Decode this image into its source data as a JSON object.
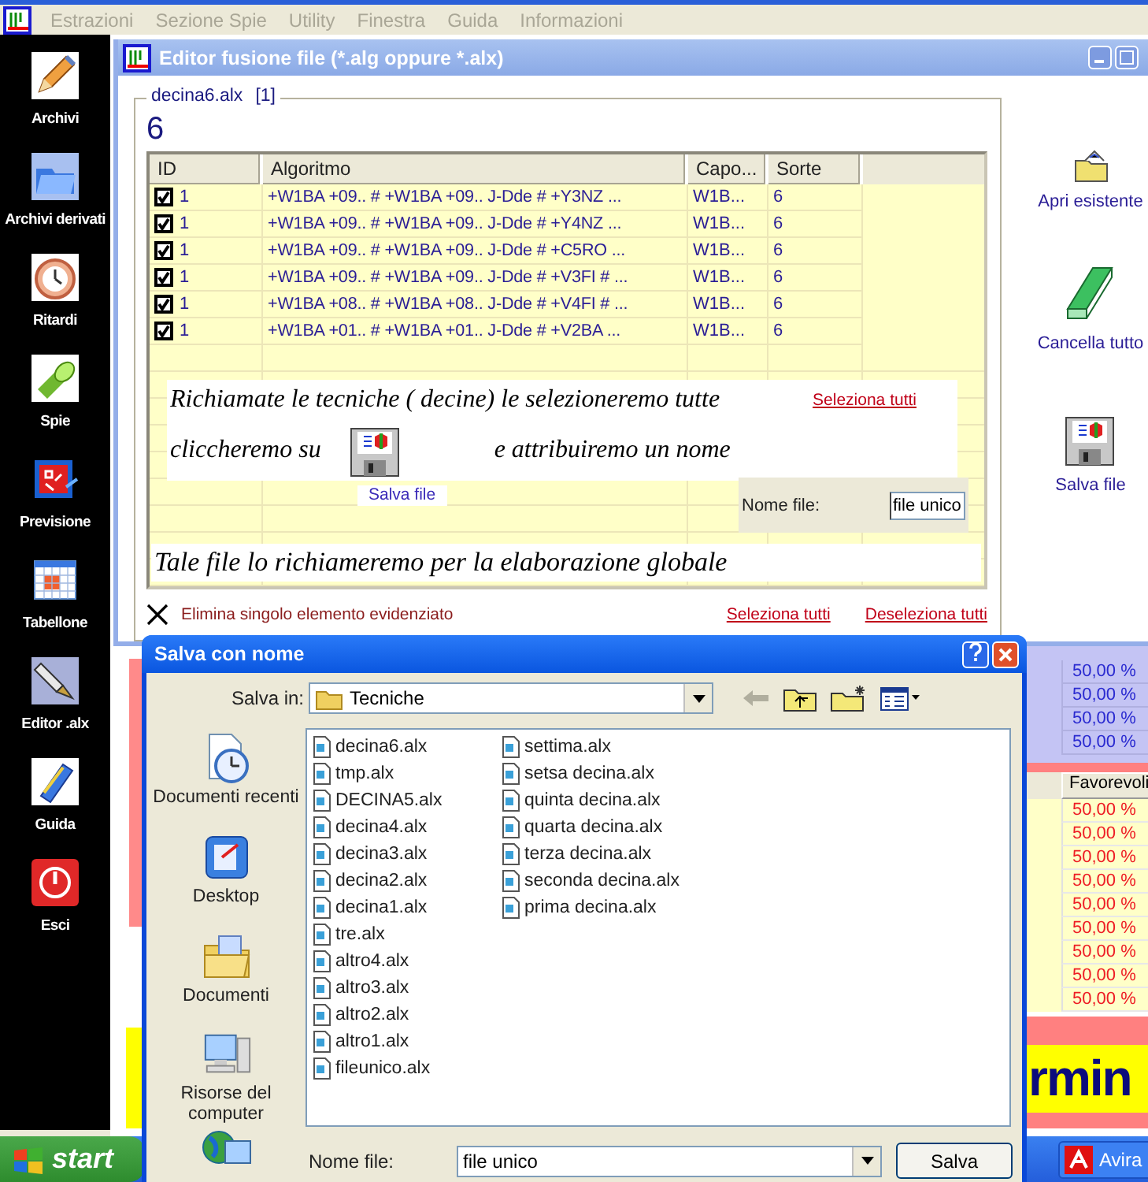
{
  "menu_bar": [
    "Estrazioni",
    "Sezione Spie",
    "Utility",
    "Finestra",
    "Guida",
    "Informazioni"
  ],
  "sidebar": [
    "Archivi",
    "Archivi derivati",
    "Ritardi",
    "Spie",
    "Previsione",
    "Tabellone",
    "Editor .alx",
    "Guida",
    "Esci"
  ],
  "editor": {
    "title": "Editor fusione file (*.alg oppure *.alx)",
    "file_name": "decina6.alx",
    "file_index": "[1]",
    "count": "6",
    "table": {
      "columns": [
        "ID",
        "Algoritmo",
        "Capo...",
        "Sorte"
      ],
      "rows": [
        {
          "checked": true,
          "id": "1",
          "algoritmo": "+W1BA +09.. # +W1BA +09.. J-Dde # +Y3NZ ...",
          "capo": "W1B...",
          "sorte": "6"
        },
        {
          "checked": true,
          "id": "1",
          "algoritmo": "+W1BA +09.. # +W1BA +09.. J-Dde # +Y4NZ ...",
          "capo": "W1B...",
          "sorte": "6"
        },
        {
          "checked": true,
          "id": "1",
          "algoritmo": "+W1BA +09.. # +W1BA +09.. J-Dde # +C5RO ...",
          "capo": "W1B...",
          "sorte": "6"
        },
        {
          "checked": true,
          "id": "1",
          "algoritmo": "+W1BA +09.. # +W1BA +09.. J-Dde # +V3FI # ...",
          "capo": "W1B...",
          "sorte": "6"
        },
        {
          "checked": true,
          "id": "1",
          "algoritmo": "+W1BA +08.. # +W1BA +08.. J-Dde # +V4FI # ...",
          "capo": "W1B...",
          "sorte": "6"
        },
        {
          "checked": true,
          "id": "1",
          "algoritmo": "+W1BA +01.. # +W1BA +01.. J-Dde # +V2BA ...",
          "capo": "W1B...",
          "sorte": "6"
        }
      ]
    },
    "instructions": {
      "line_1": "Richiamate le tecniche ( decine) le selezioneremo tutte",
      "select_all": "Seleziona tutti",
      "line_2a": "cliccheremo su",
      "save_label": "Salva file",
      "line_2b": "e attribuiremo un nome",
      "name_label": "Nome file:",
      "name_value": "file unico",
      "line_3": "Tale file lo richiameremo per la elaborazione globale"
    },
    "delete_label": "Elimina singolo elemento evidenziato",
    "select_all": "Seleziona tutti",
    "deselect_all": "Deseleziona tutti",
    "actions": [
      "Apri esistente",
      "Cancella tutto",
      "Salva file"
    ]
  },
  "dialog": {
    "title": "Salva con nome",
    "save_in_label": "Salva in:",
    "folder": "Tecniche",
    "places": [
      "Documenti recenti",
      "Desktop",
      "Documenti",
      "Risorse del computer"
    ],
    "files": [
      "decina6.alx",
      "tmp.alx",
      "DECINA5.alx",
      "decina4.alx",
      "decina3.alx",
      "decina2.alx",
      "decina1.alx",
      "tre.alx",
      "altro4.alx",
      "altro3.alx",
      "altro2.alx",
      "altro1.alx",
      "fileunico.alx",
      "settima.alx",
      "setsa decina.alx",
      "quinta decina.alx",
      "quarta decina.alx",
      "terza decina.alx",
      "seconda decina.alx",
      "prima decina.alx"
    ],
    "file_name_label": "Nome file:",
    "file_name": "file unico",
    "save_button": "Salva"
  },
  "back_window": {
    "upper_values": [
      "50,00 %",
      "50,00 %",
      "50,00 %",
      "50,00 %"
    ],
    "column_header": "Favorevoli",
    "values": [
      "50,00 %",
      "50,00 %",
      "50,00 %",
      "50,00 %",
      "50,00 %",
      "50,00 %",
      "50,00 %",
      "50,00 %",
      "50,00 %"
    ],
    "banner": "rmin"
  },
  "taskbar": {
    "start": "start",
    "tasks": [
      "Avira"
    ]
  }
}
